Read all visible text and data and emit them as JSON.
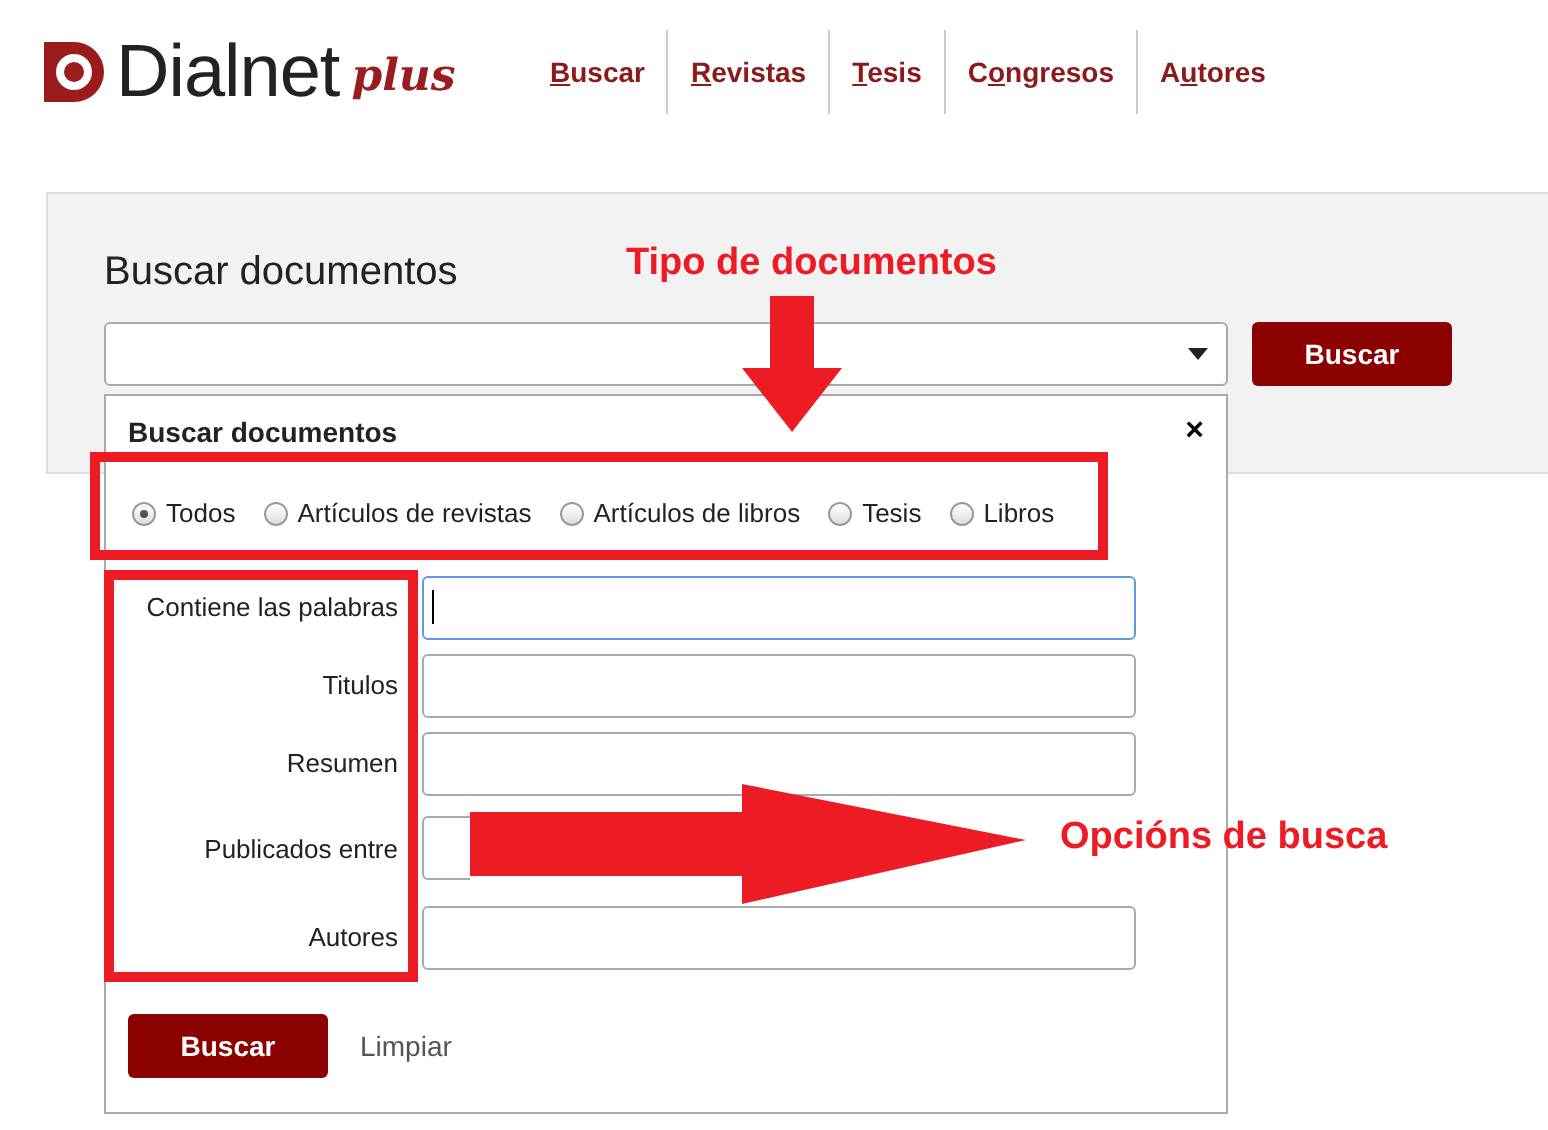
{
  "header": {
    "logo": {
      "name": "Dialnet",
      "suffix": "plus"
    },
    "nav": [
      {
        "key": "B",
        "after": "uscar"
      },
      {
        "key": "R",
        "after": "evistas"
      },
      {
        "key": "T",
        "after": "esis"
      },
      {
        "before": "C",
        "key": "o",
        "after": "ngresos"
      },
      {
        "before": "A",
        "key": "u",
        "after": "tores"
      }
    ]
  },
  "search_panel": {
    "title": "Buscar documentos",
    "button": "Buscar"
  },
  "popup": {
    "title": "Buscar documentos",
    "close": "×",
    "radios": [
      {
        "label": "Todos",
        "selected": true
      },
      {
        "label": "Artículos de revistas",
        "selected": false
      },
      {
        "label": "Artículos de libros",
        "selected": false
      },
      {
        "label": "Tesis",
        "selected": false
      },
      {
        "label": "Libros",
        "selected": false
      }
    ],
    "fields": [
      {
        "label": "Contiene las palabras",
        "kind": "text",
        "focused": true
      },
      {
        "label": "Titulos",
        "kind": "text",
        "focused": false
      },
      {
        "label": "Resumen",
        "kind": "text",
        "focused": false
      },
      {
        "label": "Publicados entre",
        "kind": "range",
        "focused": false
      },
      {
        "label": "Autores",
        "kind": "text",
        "focused": false
      }
    ],
    "submit": "Buscar",
    "clear": "Limpiar"
  },
  "annotations": {
    "types_label": "Tipo de documentos",
    "options_label": "Opcións de busca"
  }
}
